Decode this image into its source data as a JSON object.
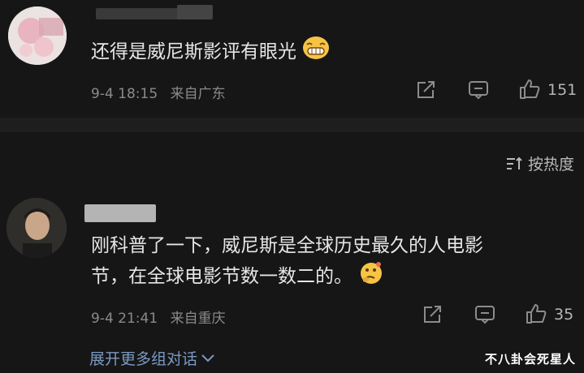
{
  "comments": [
    {
      "text": "还得是威尼斯影评有眼光",
      "emoji": "grinning-face",
      "time": "9-4 18:15",
      "location": "来自广东",
      "likes": "151",
      "icons": [
        "share-icon",
        "comment-icon",
        "like-icon"
      ]
    },
    {
      "line1": "刚科普了一下，威尼斯是全球历史最久的人电影",
      "line2": "节，在全球电影节数一数二的。",
      "emoji": "thinking-face",
      "time": "9-4 21:41",
      "location": "来自重庆",
      "likes": "35",
      "icons": [
        "share-icon",
        "comment-icon",
        "like-icon"
      ]
    }
  ],
  "sort": {
    "label": "按热度",
    "icon": "sort-icon"
  },
  "expand": {
    "label": "展开更多组对话",
    "icon": "chevron-down-icon"
  },
  "watermark": "不八卦会死星人",
  "colors": {
    "background": "#161616",
    "link": "#7a9ac2",
    "muted": "#8a8a8a"
  }
}
